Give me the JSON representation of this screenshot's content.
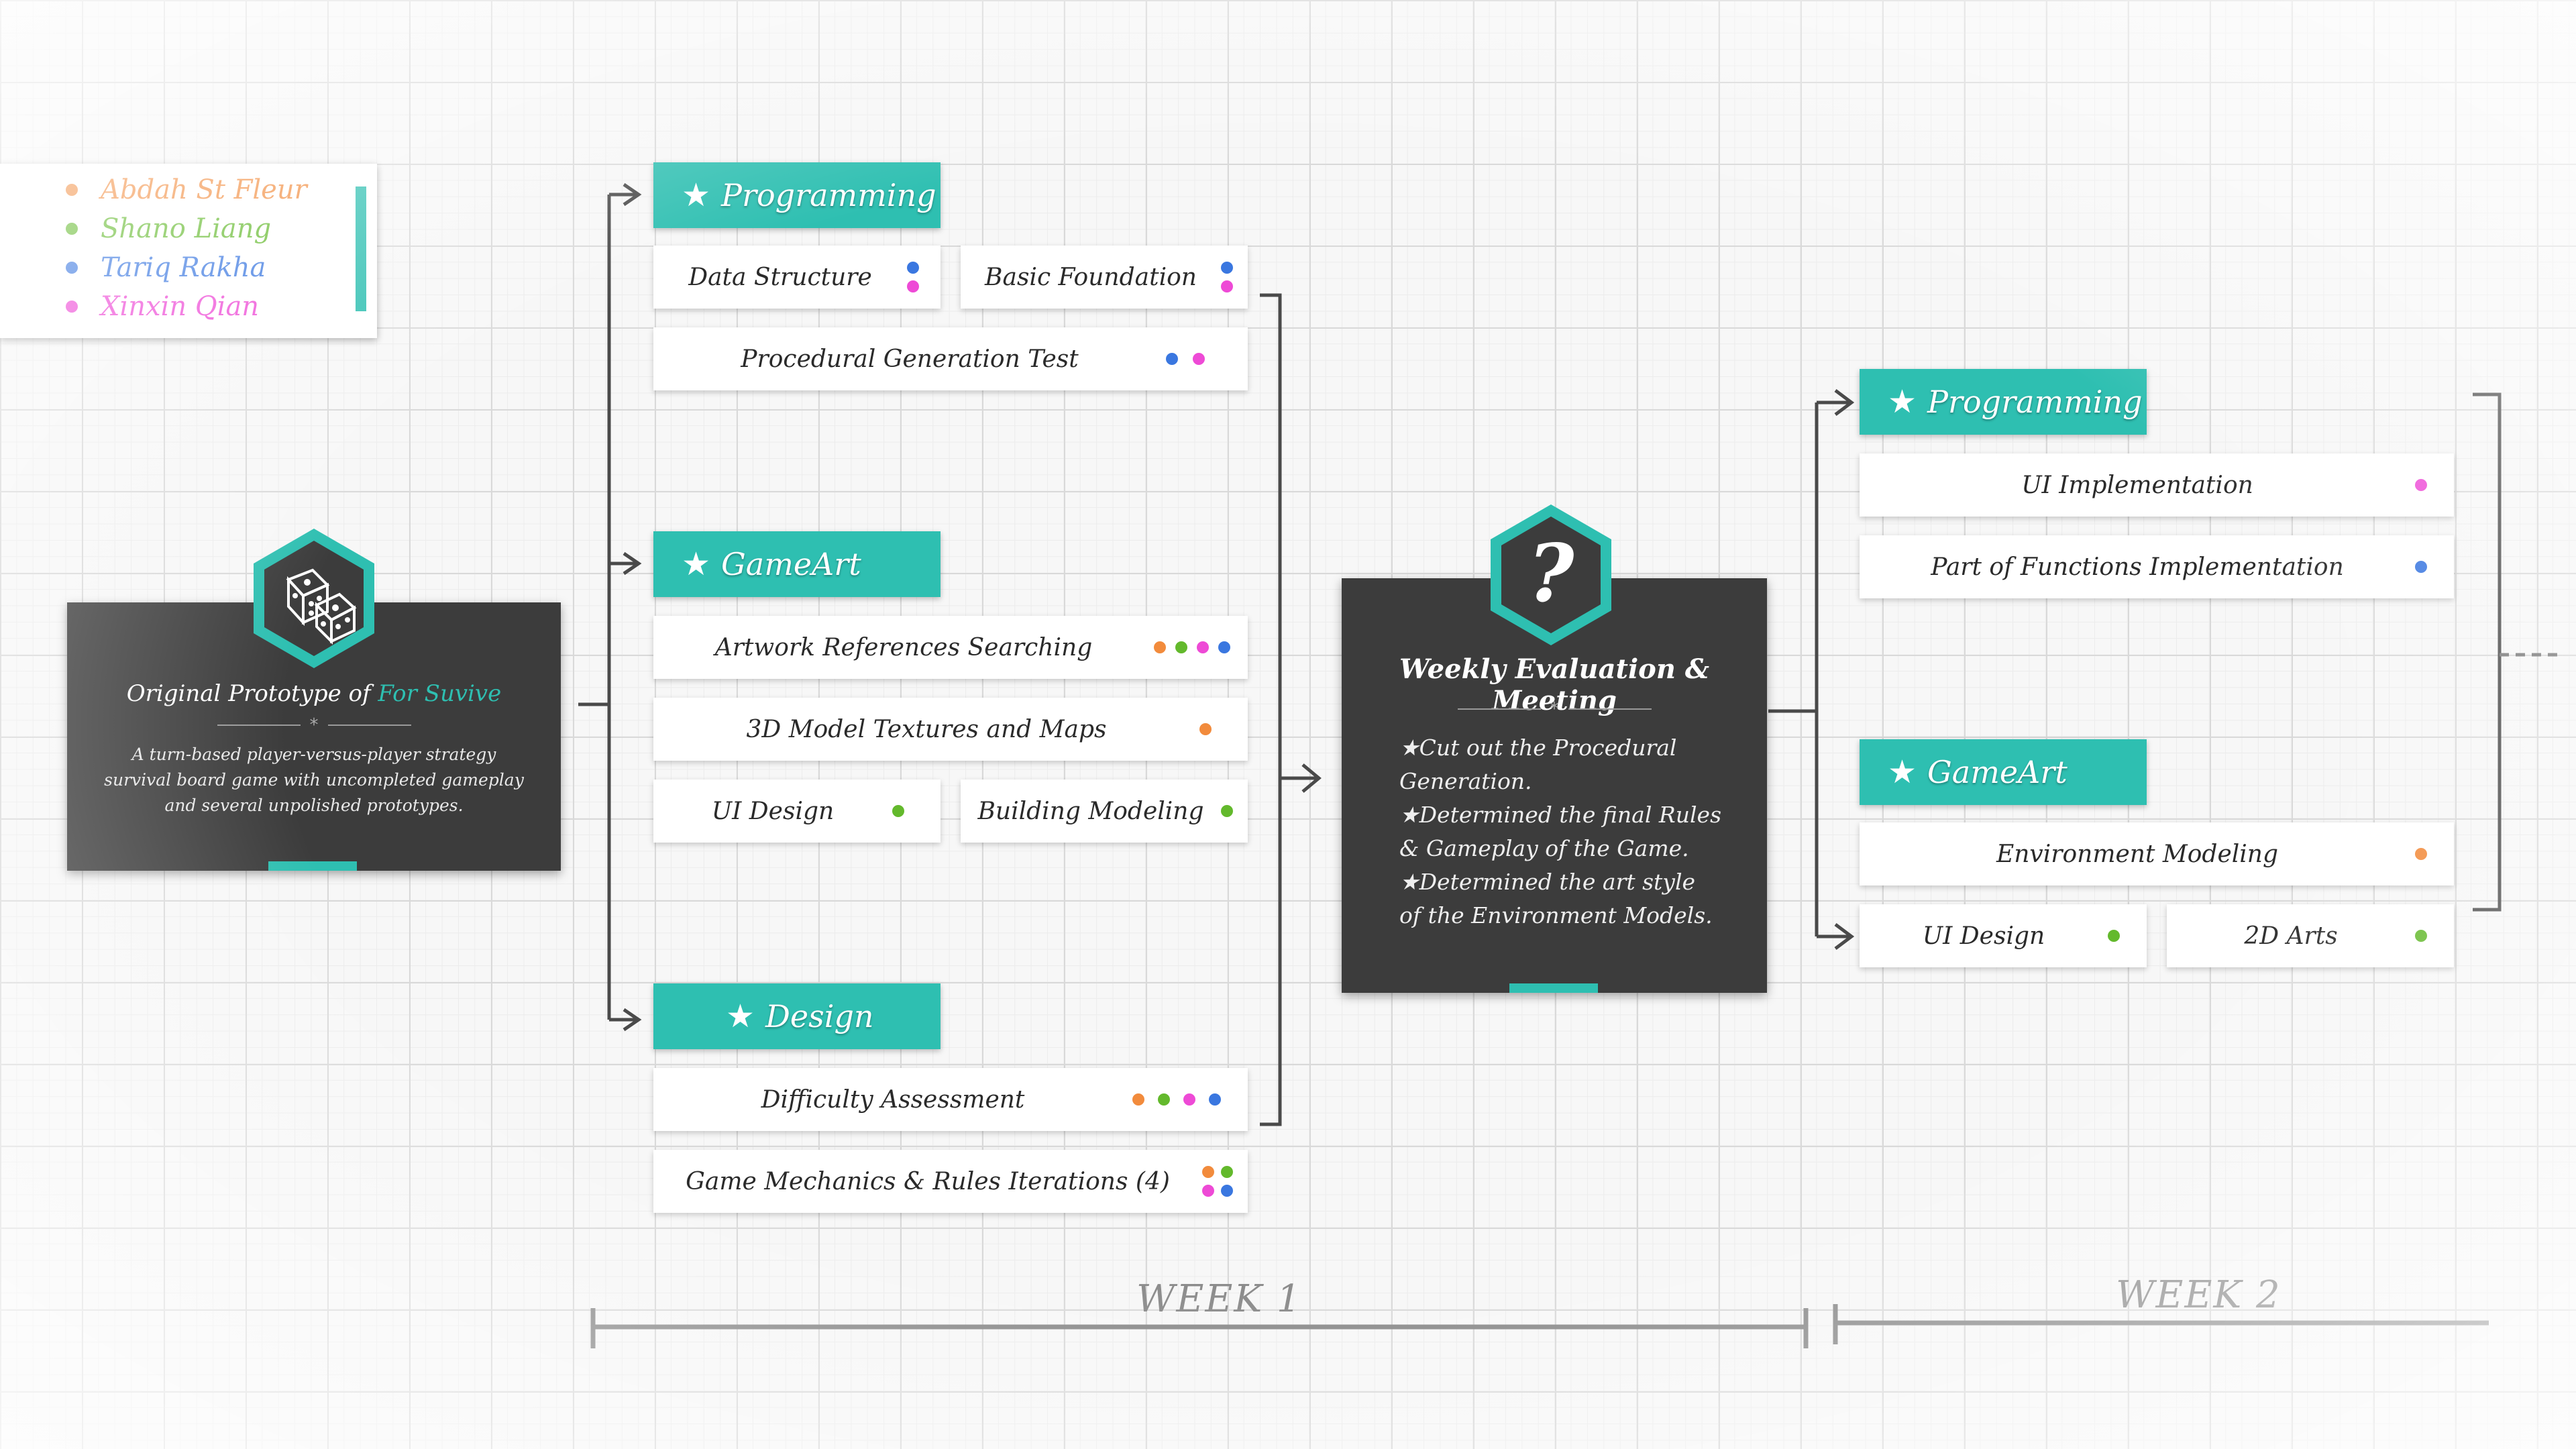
{
  "legend": [
    {
      "name": "Abdah St Fleur",
      "color": "#f28b3c"
    },
    {
      "name": "Shano Liang",
      "color": "#63b92c"
    },
    {
      "name": "Tariq Rakha",
      "color": "#3a77e0"
    },
    {
      "name": "Xinxin Qian",
      "color": "#ee4ad6"
    }
  ],
  "prototype": {
    "title_prefix": "Original Prototype of ",
    "title_highlight": "For Suvive",
    "separator_star": "*",
    "description": "A turn-based player-versus-player strategy survival board game with uncompleted gameplay and several unpolished prototypes.",
    "icon": "dice-icon"
  },
  "week1": {
    "categories": {
      "programming": "Programming",
      "gameart": "GameArt",
      "design": "Design"
    },
    "tasks": {
      "data_structure": "Data Structure",
      "basic_foundation": "Basic Foundation",
      "procedural_test": "Procedural Generation Test",
      "artwork_refs": "Artwork References Searching",
      "textures_maps": "3D Model Textures and Maps",
      "ui_design": "UI Design",
      "building_modeling": "Building Modeling",
      "difficulty": "Difficulty Assessment",
      "mechanics": "Game Mechanics & Rules Iterations (4)"
    },
    "label": "WEEK 1"
  },
  "meeting": {
    "title": "Weekly Evaluation & Meeting",
    "separator_star": "*",
    "lines": [
      "★Cut out the Procedural",
      "Generation.",
      "★Determined the final Rules",
      "& Gameplay of the Game.",
      "★Determined the art style",
      "of the Environment Models."
    ],
    "icon": "question-mark-icon"
  },
  "week2": {
    "categories": {
      "programming": "Programming",
      "gameart": "GameArt"
    },
    "tasks": {
      "ui_impl": "UI Implementation",
      "functions_impl": "Part of Functions Implementation",
      "env_modeling": "Environment Modeling",
      "ui_design": "UI Design",
      "arts_2d": "2D Arts"
    },
    "label": "WEEK 2"
  },
  "icons": {
    "star": "★"
  }
}
